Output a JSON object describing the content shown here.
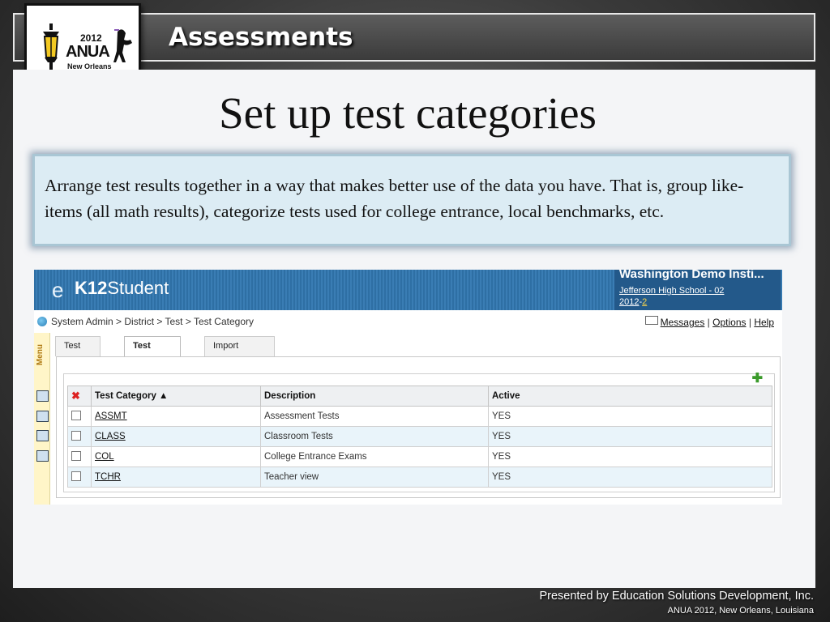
{
  "deck": {
    "title": "Assessments",
    "logo": {
      "year": "2012",
      "brand": "ANUA",
      "city": "New Orleans"
    }
  },
  "slide": {
    "title": "Set up test categories",
    "body": "Arrange test results together in a way that makes better use of the data you have. That is, group like-items (all math results), categorize tests used for college entrance, local benchmarks, etc."
  },
  "app": {
    "logo_prefix": "e",
    "logo_bold": "K12",
    "logo_rest": "Student",
    "institution_name": "Washington Demo Insti...",
    "school": "Jefferson High School - 02",
    "year_prefix": "2012",
    "year_sep": "-",
    "year_suffix": "2",
    "breadcrumb": "System Admin > District > Test > Test Category",
    "links": {
      "messages": "Messages",
      "sep": "|",
      "options": "Options",
      "help": "Help"
    },
    "menu_label": "Menu",
    "tabs": [
      {
        "label": "Test Master",
        "active": false
      },
      {
        "label": "Test Category",
        "active": true
      },
      {
        "label": "Import Configuration",
        "active": false
      }
    ],
    "table": {
      "columns": [
        "Test Category ▲",
        "Description",
        "Active"
      ],
      "rows": [
        {
          "code": "ASSMT",
          "description": "Assessment Tests",
          "active": "YES"
        },
        {
          "code": "CLASS",
          "description": "Classroom Tests",
          "active": "YES"
        },
        {
          "code": "COL",
          "description": "College Entrance Exams",
          "active": "YES"
        },
        {
          "code": "TCHR",
          "description": "Teacher view",
          "active": "YES"
        }
      ]
    }
  },
  "footer": {
    "line1": "Presented by Education Solutions Development, Inc.",
    "line2": "ANUA 2012, New Orleans, Louisiana"
  },
  "icons": {
    "logo": "lantern-icon",
    "add": "plus-icon",
    "delete": "delete-icon",
    "mail": "mail-icon",
    "breadcrumb": "globe-icon",
    "sidebar": [
      "printer-icon",
      "chart-icon",
      "report-icon",
      "export-icon"
    ]
  },
  "colors": {
    "header_blue": "#2e6fa4",
    "institution_blue": "#23598a",
    "row_alt": "#e9f4fa",
    "callout_bg": "#dcecf4",
    "menu_bg": "#fff5c8"
  }
}
